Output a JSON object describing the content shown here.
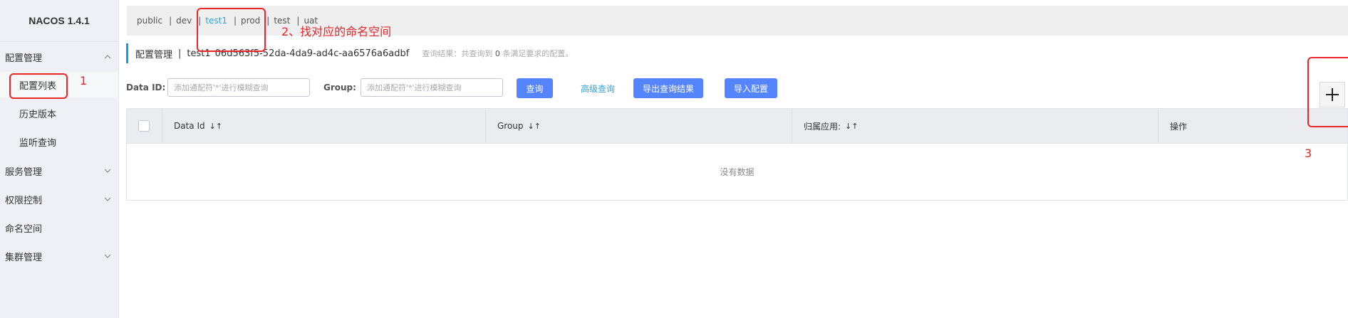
{
  "app": {
    "title": "NACOS 1.4.1"
  },
  "sidebar": {
    "items": [
      {
        "label": "配置管理",
        "type": "group",
        "expanded": true
      },
      {
        "label": "配置列表",
        "type": "sub",
        "active": true
      },
      {
        "label": "历史版本",
        "type": "sub"
      },
      {
        "label": "监听查询",
        "type": "sub"
      },
      {
        "label": "服务管理",
        "type": "group",
        "expanded": false
      },
      {
        "label": "权限控制",
        "type": "group",
        "expanded": false
      },
      {
        "label": "命名空间",
        "type": "group"
      },
      {
        "label": "集群管理",
        "type": "group",
        "expanded": false
      }
    ]
  },
  "namespaces": {
    "items": [
      "public",
      "dev",
      "test1",
      "prod",
      "test",
      "uat"
    ],
    "separator": "|",
    "active": "test1"
  },
  "header": {
    "title": "配置管理",
    "separator": "|",
    "namespace_id": "test1",
    "namespace_uuid": "06d563f5-52da-4da9-ad4c-aa6576a6adbf",
    "result_prefix": "查询结果：共查询到",
    "result_count": "0",
    "result_suffix": "条满足要求的配置。"
  },
  "search": {
    "data_id_label": "Data ID:",
    "data_id_placeholder": "添加通配符'*'进行模糊查询",
    "group_label": "Group:",
    "group_placeholder": "添加通配符'*'进行模糊查询",
    "query_button": "查询",
    "advanced_link": "高级查询",
    "export_button": "导出查询结果",
    "import_button": "导入配置"
  },
  "table": {
    "columns": [
      "Data Id",
      "Group",
      "归属应用:",
      "操作"
    ],
    "sort_icon": "↓↑",
    "empty_text": "没有数据"
  },
  "annotations": {
    "label_1": "1",
    "label_2": "2、找对应的命名空间",
    "label_3": "3",
    "color": "#e8262b"
  },
  "icons": {
    "add": "plus-icon",
    "chevron": "chevron-icon",
    "sort": "sort-icon"
  }
}
